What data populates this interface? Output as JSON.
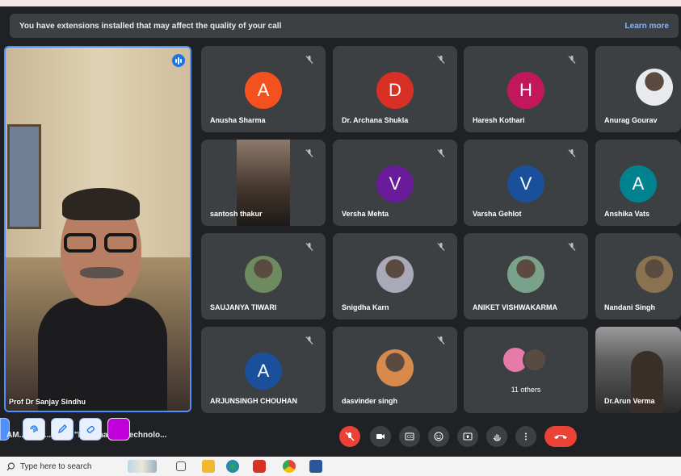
{
  "banner": {
    "text": "You have extensions installed that may affect the quality of your call",
    "link": "Learn more"
  },
  "main_tile": {
    "name": "Prof Dr Sanjay Sindhu"
  },
  "tiles": [
    {
      "name": "Anusha Sharma",
      "initial": "A",
      "color": "#f4511e"
    },
    {
      "name": "Dr. Archana Shukla",
      "initial": "D",
      "color": "#d93025"
    },
    {
      "name": "Haresh Kothari",
      "initial": "H",
      "color": "#c2185b"
    },
    {
      "name": "Anurag Gourav",
      "initial": "",
      "color": "#e8eaed"
    },
    {
      "name": "santosh thakur",
      "initial": "",
      "color": ""
    },
    {
      "name": "Versha Mehta",
      "initial": "V",
      "color": "#6a1b9a"
    },
    {
      "name": "Varsha Gehlot",
      "initial": "V",
      "color": "#1a4f9c"
    },
    {
      "name": "Anshika Vats",
      "initial": "A",
      "color": "#00838f"
    },
    {
      "name": "SAUJANYA TIWARI",
      "initial": "",
      "color": "#6d8b5e"
    },
    {
      "name": "Snigdha Karn",
      "initial": "",
      "color": "#a9a9b7"
    },
    {
      "name": "ANIKET VISHWAKARMA",
      "initial": "",
      "color": "#7aa18a"
    },
    {
      "name": "Nandani Singh",
      "initial": "",
      "color": "#8a7150"
    },
    {
      "name": "ARJUNSINGH CHOUHAN",
      "initial": "A",
      "color": "#1a4f9c"
    },
    {
      "name": "dasvinder singh",
      "initial": "",
      "color": "#d88a4c"
    },
    {
      "name": "11 others",
      "initial": "",
      "color": "#e57ba6"
    },
    {
      "name": "Dr.Arun Verma",
      "initial": "",
      "color": ""
    }
  ],
  "bottombar": {
    "meeting_title": "AM... te... ...ce on \"Information Technolo...",
    "controls": [
      "mic-off-icon",
      "camera-icon",
      "captions-icon",
      "emoji-icon",
      "present-icon",
      "raise-hand-icon",
      "more-icon",
      "hang-up-icon"
    ]
  },
  "taskbar": {
    "search_placeholder": "Type here to search"
  }
}
